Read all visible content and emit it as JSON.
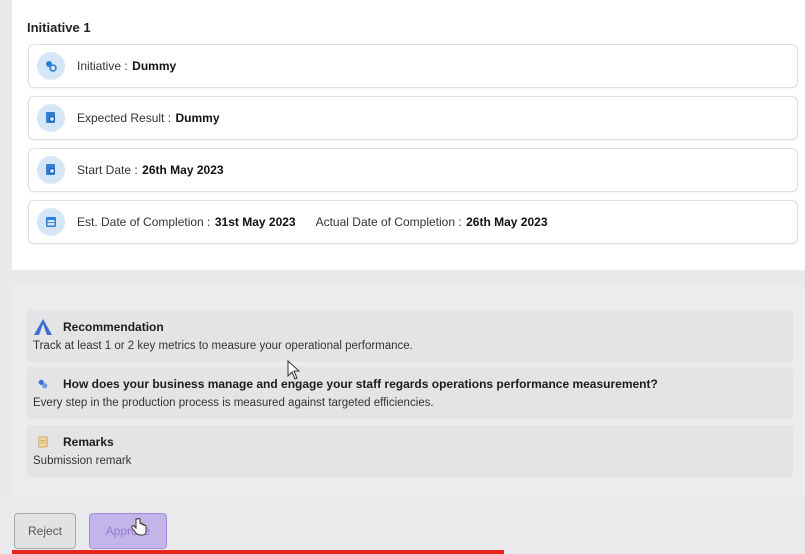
{
  "initiative": {
    "section_title": "Initiative 1",
    "cards": [
      {
        "label": "Initiative : ",
        "value": "Dummy"
      },
      {
        "label": "Expected Result : ",
        "value": "Dummy"
      },
      {
        "label": "Start Date : ",
        "value": "26th May 2023"
      },
      {
        "label": "Est. Date of Completion : ",
        "value": "31st May 2023",
        "label2": "Actual Date of Completion : ",
        "value2": "26th May 2023"
      }
    ]
  },
  "recommendations": [
    {
      "icon": "triangle-logo-icon",
      "title": "Recommendation",
      "text": "Track at least 1 or 2 key metrics to measure your operational performance."
    },
    {
      "icon": "puzzle-icon",
      "title": "How does your business manage and engage your staff regards operations performance measurement?",
      "text": "Every step in the production process is measured against targeted efficiencies."
    },
    {
      "icon": "note-icon",
      "title": "Remarks",
      "text": "Submission remark"
    }
  ],
  "actions": {
    "reject_label": "Reject",
    "approve_label": "Approve"
  },
  "colors": {
    "accent": "#c3b4ea",
    "icon_bg": "#d5e6f9",
    "progress": "#e8231c"
  },
  "video_progress": 0.62
}
